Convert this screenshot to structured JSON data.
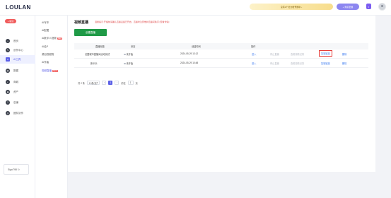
{
  "header": {
    "logo": "LOULAN",
    "notice": "没有2个社交帐号绑中 ›",
    "buy_label": "购买套餐",
    "buy_icon": "+"
  },
  "sidebar": {
    "new_button": "+ 新建",
    "items": [
      {
        "label": "首页",
        "icon": "home-icon",
        "glyph": "⌂"
      },
      {
        "label": "创作中心",
        "icon": "create-icon",
        "glyph": "✎"
      },
      {
        "label": "AI工具",
        "icon": "ai-tools-icon",
        "glyph": "A"
      },
      {
        "label": "数据",
        "icon": "data-icon",
        "glyph": "▤"
      },
      {
        "label": "商城",
        "icon": "shop-icon",
        "glyph": "◐"
      },
      {
        "label": "资产",
        "icon": "assets-icon",
        "glyph": "◉"
      },
      {
        "label": "店铺",
        "icon": "store-icon",
        "glyph": "⛉"
      },
      {
        "label": "团队协作",
        "icon": "team-icon",
        "glyph": "◎"
      }
    ],
    "bottom_label": "Sign798 ↻"
  },
  "subnav": {
    "items": [
      {
        "label": "AI写作",
        "badge": ""
      },
      {
        "label": "AI配图",
        "badge": ""
      },
      {
        "label": "AI数字人视频",
        "badge": "NEW"
      },
      {
        "label": "AI绘P",
        "badge": ""
      },
      {
        "label": "源目视频剪",
        "badge": ""
      },
      {
        "label": "AI作曲",
        "badge": ""
      },
      {
        "label": "视频直播",
        "badge": "NEW"
      }
    ]
  },
  "main": {
    "title": "视频直播",
    "tip": "温馨提示:开播前请确认直播设备已开启，直播时注意维护直播间秩序 [查看详情]",
    "create_button": "创建直播",
    "columns": [
      "直播标题",
      "状态",
      "创建时间",
      "操作"
    ],
    "rows": [
      {
        "title": "法国城市直播间活动测试",
        "status": "未开始",
        "created": "2024-05-29 13:12",
        "actions": [
          "进入",
          "停止直播",
          "查看观看记录",
          "复制链接",
          "删除"
        ]
      },
      {
        "title": "新卡乐",
        "status": "未开始",
        "created": "2024-05-29 10:48",
        "actions": [
          "进入",
          "停止直播",
          "查看观看记录",
          "复制链接",
          "删除"
        ]
      }
    ],
    "pagination": {
      "total": "共 2 条",
      "page_size": "10条/页",
      "prev": "‹",
      "current_page": "1",
      "next": "›",
      "goto_label": "前往",
      "goto_value": "1",
      "page_suffix": "页"
    }
  },
  "colors": {
    "accent": "#5b5fe6",
    "create_button": "#1f9a47",
    "new_button": "#f05b5b",
    "link": "#3d7bf0"
  }
}
